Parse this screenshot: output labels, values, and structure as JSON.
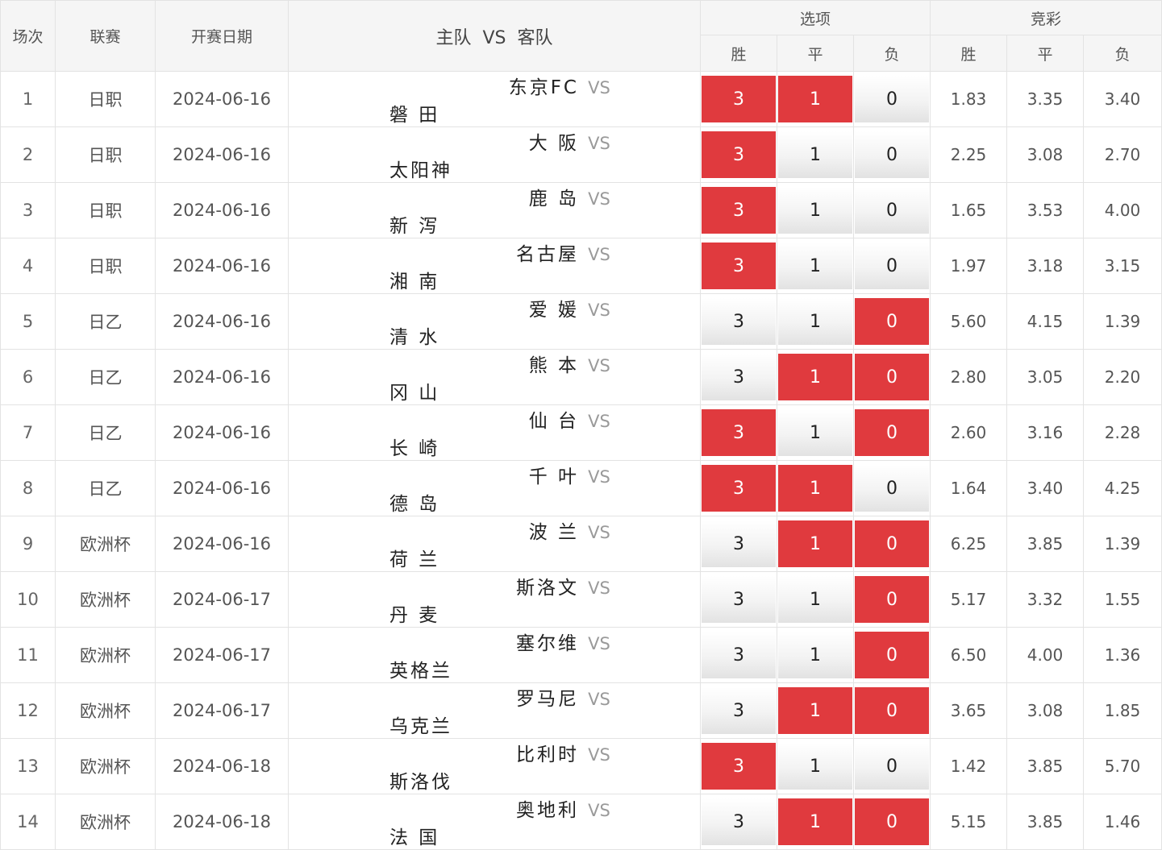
{
  "headers": {
    "index": "场次",
    "league": "联赛",
    "date": "开赛日期",
    "home": "主队",
    "vs": "VS",
    "away": "客队",
    "options_group": "选项",
    "odds_group": "竞彩",
    "win": "胜",
    "draw": "平",
    "loss": "负"
  },
  "colors": {
    "selected": "#e03a3e",
    "header_bg": "#f5f5f5",
    "border": "#e3e3e3"
  },
  "rows": [
    {
      "index": "1",
      "league": "日职",
      "date": "2024-06-16",
      "home": "东京FC",
      "away": "磐 田",
      "opt": [
        "3",
        "1",
        "0"
      ],
      "sel": [
        true,
        true,
        false
      ],
      "odds": [
        "1.83",
        "3.35",
        "3.40"
      ]
    },
    {
      "index": "2",
      "league": "日职",
      "date": "2024-06-16",
      "home": "大 阪",
      "away": "太阳神",
      "opt": [
        "3",
        "1",
        "0"
      ],
      "sel": [
        true,
        false,
        false
      ],
      "odds": [
        "2.25",
        "3.08",
        "2.70"
      ]
    },
    {
      "index": "3",
      "league": "日职",
      "date": "2024-06-16",
      "home": "鹿 岛",
      "away": "新 泻",
      "opt": [
        "3",
        "1",
        "0"
      ],
      "sel": [
        true,
        false,
        false
      ],
      "odds": [
        "1.65",
        "3.53",
        "4.00"
      ]
    },
    {
      "index": "4",
      "league": "日职",
      "date": "2024-06-16",
      "home": "名古屋",
      "away": "湘 南",
      "opt": [
        "3",
        "1",
        "0"
      ],
      "sel": [
        true,
        false,
        false
      ],
      "odds": [
        "1.97",
        "3.18",
        "3.15"
      ]
    },
    {
      "index": "5",
      "league": "日乙",
      "date": "2024-06-16",
      "home": "爱 媛",
      "away": "清 水",
      "opt": [
        "3",
        "1",
        "0"
      ],
      "sel": [
        false,
        false,
        true
      ],
      "odds": [
        "5.60",
        "4.15",
        "1.39"
      ]
    },
    {
      "index": "6",
      "league": "日乙",
      "date": "2024-06-16",
      "home": "熊 本",
      "away": "冈 山",
      "opt": [
        "3",
        "1",
        "0"
      ],
      "sel": [
        false,
        true,
        true
      ],
      "odds": [
        "2.80",
        "3.05",
        "2.20"
      ]
    },
    {
      "index": "7",
      "league": "日乙",
      "date": "2024-06-16",
      "home": "仙 台",
      "away": "长 崎",
      "opt": [
        "3",
        "1",
        "0"
      ],
      "sel": [
        true,
        false,
        true
      ],
      "odds": [
        "2.60",
        "3.16",
        "2.28"
      ]
    },
    {
      "index": "8",
      "league": "日乙",
      "date": "2024-06-16",
      "home": "千 叶",
      "away": "德 岛",
      "opt": [
        "3",
        "1",
        "0"
      ],
      "sel": [
        true,
        true,
        false
      ],
      "odds": [
        "1.64",
        "3.40",
        "4.25"
      ]
    },
    {
      "index": "9",
      "league": "欧洲杯",
      "date": "2024-06-16",
      "home": "波 兰",
      "away": "荷 兰",
      "opt": [
        "3",
        "1",
        "0"
      ],
      "sel": [
        false,
        true,
        true
      ],
      "odds": [
        "6.25",
        "3.85",
        "1.39"
      ]
    },
    {
      "index": "10",
      "league": "欧洲杯",
      "date": "2024-06-17",
      "home": "斯洛文",
      "away": "丹 麦",
      "opt": [
        "3",
        "1",
        "0"
      ],
      "sel": [
        false,
        false,
        true
      ],
      "odds": [
        "5.17",
        "3.32",
        "1.55"
      ]
    },
    {
      "index": "11",
      "league": "欧洲杯",
      "date": "2024-06-17",
      "home": "塞尔维",
      "away": "英格兰",
      "opt": [
        "3",
        "1",
        "0"
      ],
      "sel": [
        false,
        false,
        true
      ],
      "odds": [
        "6.50",
        "4.00",
        "1.36"
      ]
    },
    {
      "index": "12",
      "league": "欧洲杯",
      "date": "2024-06-17",
      "home": "罗马尼",
      "away": "乌克兰",
      "opt": [
        "3",
        "1",
        "0"
      ],
      "sel": [
        false,
        true,
        true
      ],
      "odds": [
        "3.65",
        "3.08",
        "1.85"
      ]
    },
    {
      "index": "13",
      "league": "欧洲杯",
      "date": "2024-06-18",
      "home": "比利时",
      "away": "斯洛伐",
      "opt": [
        "3",
        "1",
        "0"
      ],
      "sel": [
        true,
        false,
        false
      ],
      "odds": [
        "1.42",
        "3.85",
        "5.70"
      ]
    },
    {
      "index": "14",
      "league": "欧洲杯",
      "date": "2024-06-18",
      "home": "奥地利",
      "away": "法 国",
      "opt": [
        "3",
        "1",
        "0"
      ],
      "sel": [
        false,
        true,
        true
      ],
      "odds": [
        "5.15",
        "3.85",
        "1.46"
      ]
    }
  ]
}
